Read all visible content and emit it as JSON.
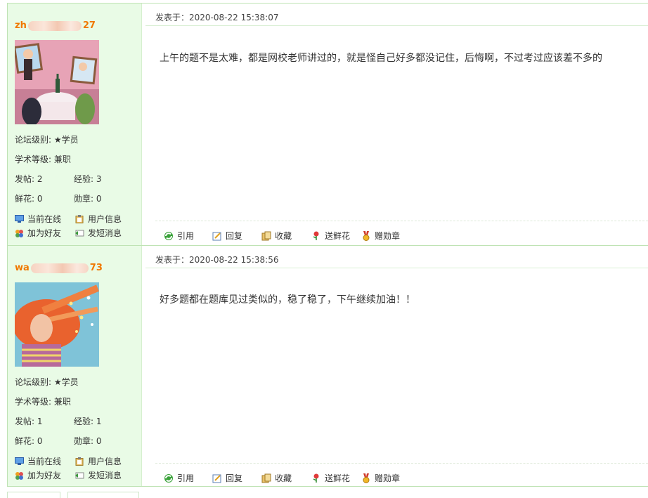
{
  "labels": {
    "posted_at_prefix": "发表于：",
    "forum_level": "论坛级别:",
    "academic_level": "学术等级:",
    "posts": "发帖:",
    "experience": "经验:",
    "flowers": "鲜花:",
    "medals": "勋章:"
  },
  "user_actions": [
    "当前在线",
    "用户信息",
    "加为好友",
    "发短消息"
  ],
  "post_actions": [
    "引用",
    "回复",
    "收藏",
    "送鲜花",
    "赠勋章"
  ],
  "posts": [
    {
      "user": {
        "name_start": "zh",
        "name_end": "27",
        "forum_level": "★学员",
        "academic_level": "兼职",
        "posts": "2",
        "experience": "3",
        "flowers": "0",
        "medals": "0"
      },
      "posted_at": "2020-08-22 15:38:07",
      "content": "上午的题不是太难，都是网校老师讲过的，就是怪自己好多都没记住，后悔啊，不过考过应该差不多的"
    },
    {
      "user": {
        "name_start": "wa",
        "name_end": "73",
        "forum_level": "★学员",
        "academic_level": "兼职",
        "posts": "1",
        "experience": "1",
        "flowers": "0",
        "medals": "0"
      },
      "posted_at": "2020-08-22 15:38:56",
      "content": "好多题都在题库见过类似的，稳了稳了，下午继续加油！！"
    }
  ],
  "colors": {
    "username": "#f07800",
    "sidebar_bg": "#e9fbe6",
    "border": "#bfe3b4"
  }
}
